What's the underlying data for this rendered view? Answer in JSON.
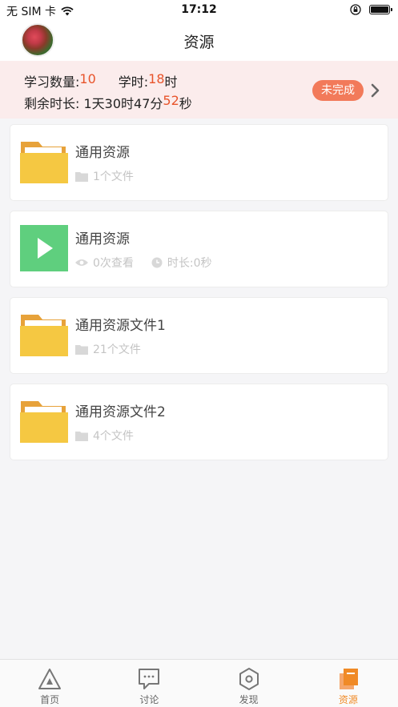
{
  "status_bar": {
    "carrier": "无 SIM 卡",
    "time": "17:12"
  },
  "nav": {
    "title": "资源"
  },
  "banner": {
    "study_count_label": "学习数量:",
    "study_count_value": "10",
    "hours_label": "学时:",
    "hours_value": "18",
    "hours_unit": "时",
    "remaining_label": "剩余时长: 1天30时47分",
    "remaining_seconds": "52",
    "remaining_unit": "秒",
    "status": "未完成"
  },
  "resources": [
    {
      "type": "folder",
      "title": "通用资源",
      "file_count": "1个文件"
    },
    {
      "type": "video",
      "title": "通用资源",
      "views": "0次查看",
      "duration": "时长:0秒"
    },
    {
      "type": "folder",
      "title": "通用资源文件1",
      "file_count": "21个文件"
    },
    {
      "type": "folder",
      "title": "通用资源文件2",
      "file_count": "4个文件"
    }
  ],
  "tabs": [
    {
      "label": "首页",
      "icon": "home-triangle-icon",
      "active": false
    },
    {
      "label": "讨论",
      "icon": "chat-bubble-icon",
      "active": false
    },
    {
      "label": "发现",
      "icon": "hexagon-discover-icon",
      "active": false
    },
    {
      "label": "资源",
      "icon": "resource-stack-icon",
      "active": true
    }
  ],
  "colors": {
    "accent": "#f08a26",
    "highlight": "#e8542b",
    "pill": "#f27a5a",
    "folder": "#f5c842",
    "video": "#5fcf7e"
  }
}
